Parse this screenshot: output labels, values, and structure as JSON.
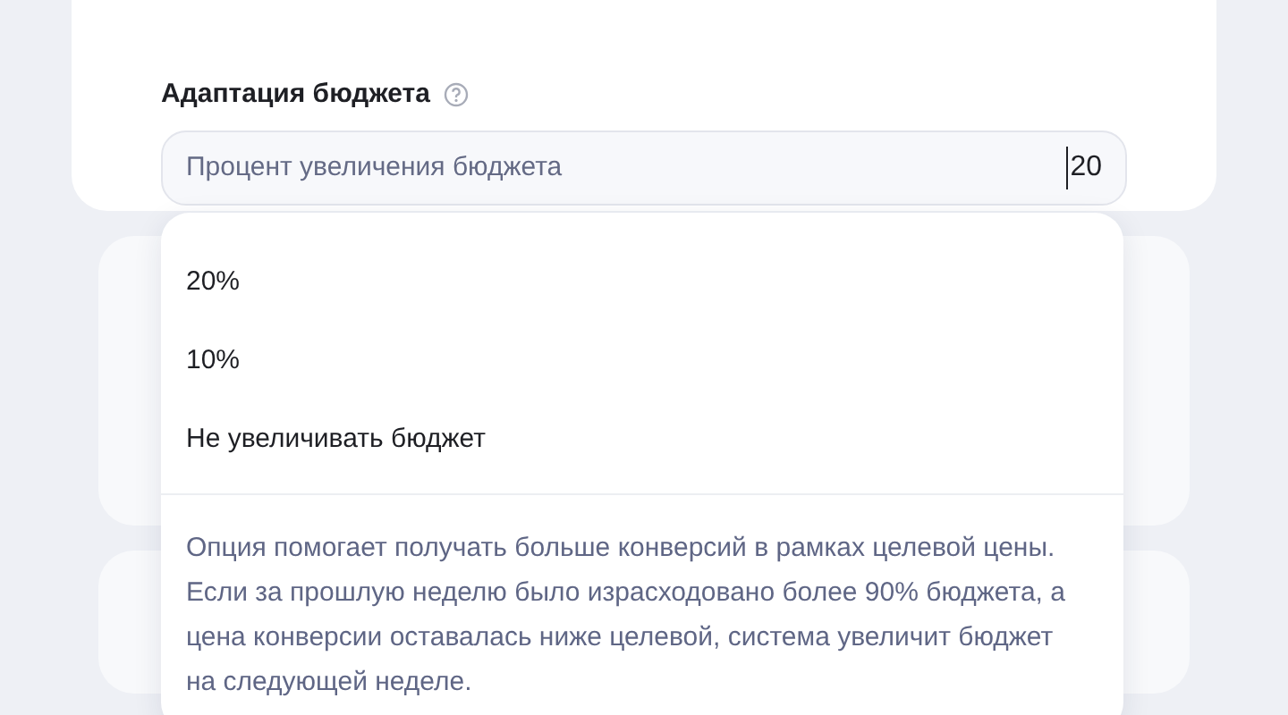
{
  "section": {
    "title": "Адаптация бюджета"
  },
  "field": {
    "label": "Процент увеличения бюджета",
    "value": "20"
  },
  "dropdown": {
    "options": [
      {
        "label": "20%"
      },
      {
        "label": "10%"
      },
      {
        "label": "Не увеличивать бюджет"
      }
    ],
    "description": "Опция помогает получать больше конверсий в рамках целевой цены. Если за прошлую неделю было израсходовано более 90% бюджета, а цена конверсии оставалась ниже целевой, система увеличит бюджет на следующей неделе."
  }
}
